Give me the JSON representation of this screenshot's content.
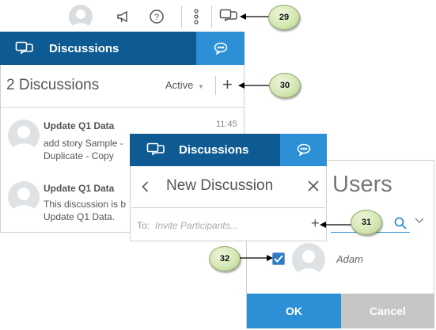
{
  "toolbar": {
    "icons": [
      "user-avatar",
      "megaphone-icon",
      "help-icon",
      "more-vertical-icon",
      "discussions-icon"
    ]
  },
  "callouts": {
    "c29": "29",
    "c30": "30",
    "c31": "31",
    "c32": "32"
  },
  "panel_list": {
    "header_title": "Discussions",
    "count_label": "2 Discussions",
    "filter_label": "Active",
    "add_label": "+",
    "items": [
      {
        "title": "Update Q1 Data",
        "time": "11:45",
        "line1": "add story Sample -",
        "line2": "Duplicate - Copy"
      },
      {
        "title": "Update Q1 Data",
        "line1": "This discussion is b",
        "line2": "Update Q1 Data."
      }
    ]
  },
  "panel_new": {
    "header_title": "Discussions",
    "title": "New Discussion",
    "to_label": "To:",
    "invite_placeholder": "Invite Participants...",
    "add_label": "+"
  },
  "panel_users": {
    "title": "Users",
    "user_name": "Adam",
    "ok_label": "OK",
    "cancel_label": "Cancel"
  },
  "colors": {
    "header_dark": "#0e5b93",
    "header_light": "#2d8fd5",
    "cancel_gray": "#c6c6c6"
  }
}
